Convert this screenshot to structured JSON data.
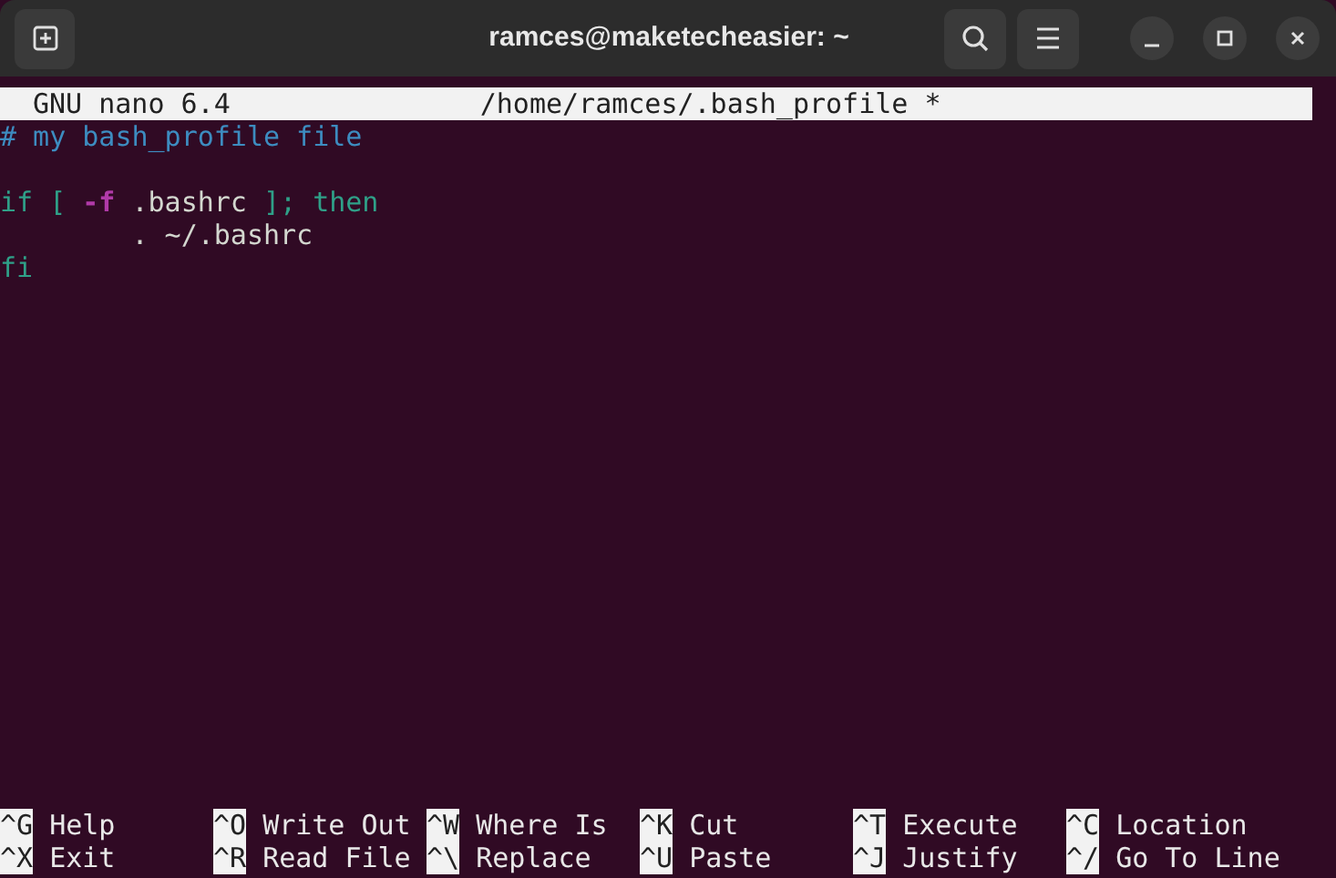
{
  "window": {
    "title": "ramces@maketecheasier: ~"
  },
  "nano_header": {
    "version": "GNU nano 6.4",
    "file": "/home/ramces/.bash_profile *"
  },
  "paragraphs": [
    {
      "lines": [
        {
          "tokens": [
            {
              "text": "# my bash_profile file",
              "kind": "comment"
            }
          ]
        }
      ]
    },
    {
      "lines": [
        {
          "tokens": [
            {
              "text": "if",
              "kind": "keyword"
            },
            {
              "text": " [ ",
              "kind": "keyword"
            },
            {
              "text": "-f",
              "kind": "option"
            },
            {
              "text": " .bashrc ",
              "kind": "plain"
            },
            {
              "text": "]; then",
              "kind": "keyword"
            }
          ]
        },
        {
          "tokens": [
            {
              "text": "        . ~/.bashrc",
              "kind": "plain"
            }
          ]
        },
        {
          "tokens": [
            {
              "text": "fi",
              "kind": "keyword"
            }
          ]
        }
      ]
    }
  ],
  "shortcut_rows": [
    [
      {
        "key": "^G",
        "label": "Help"
      },
      {
        "key": "^O",
        "label": "Write Out"
      },
      {
        "key": "^W",
        "label": "Where Is"
      },
      {
        "key": "^K",
        "label": "Cut"
      },
      {
        "key": "^T",
        "label": "Execute"
      },
      {
        "key": "^C",
        "label": "Location"
      }
    ],
    [
      {
        "key": "^X",
        "label": "Exit"
      },
      {
        "key": "^R",
        "label": "Read File"
      },
      {
        "key": "^\\",
        "label": "Replace"
      },
      {
        "key": "^U",
        "label": "Paste"
      },
      {
        "key": "^J",
        "label": "Justify"
      },
      {
        "key": "^/",
        "label": "Go To Line"
      }
    ]
  ]
}
